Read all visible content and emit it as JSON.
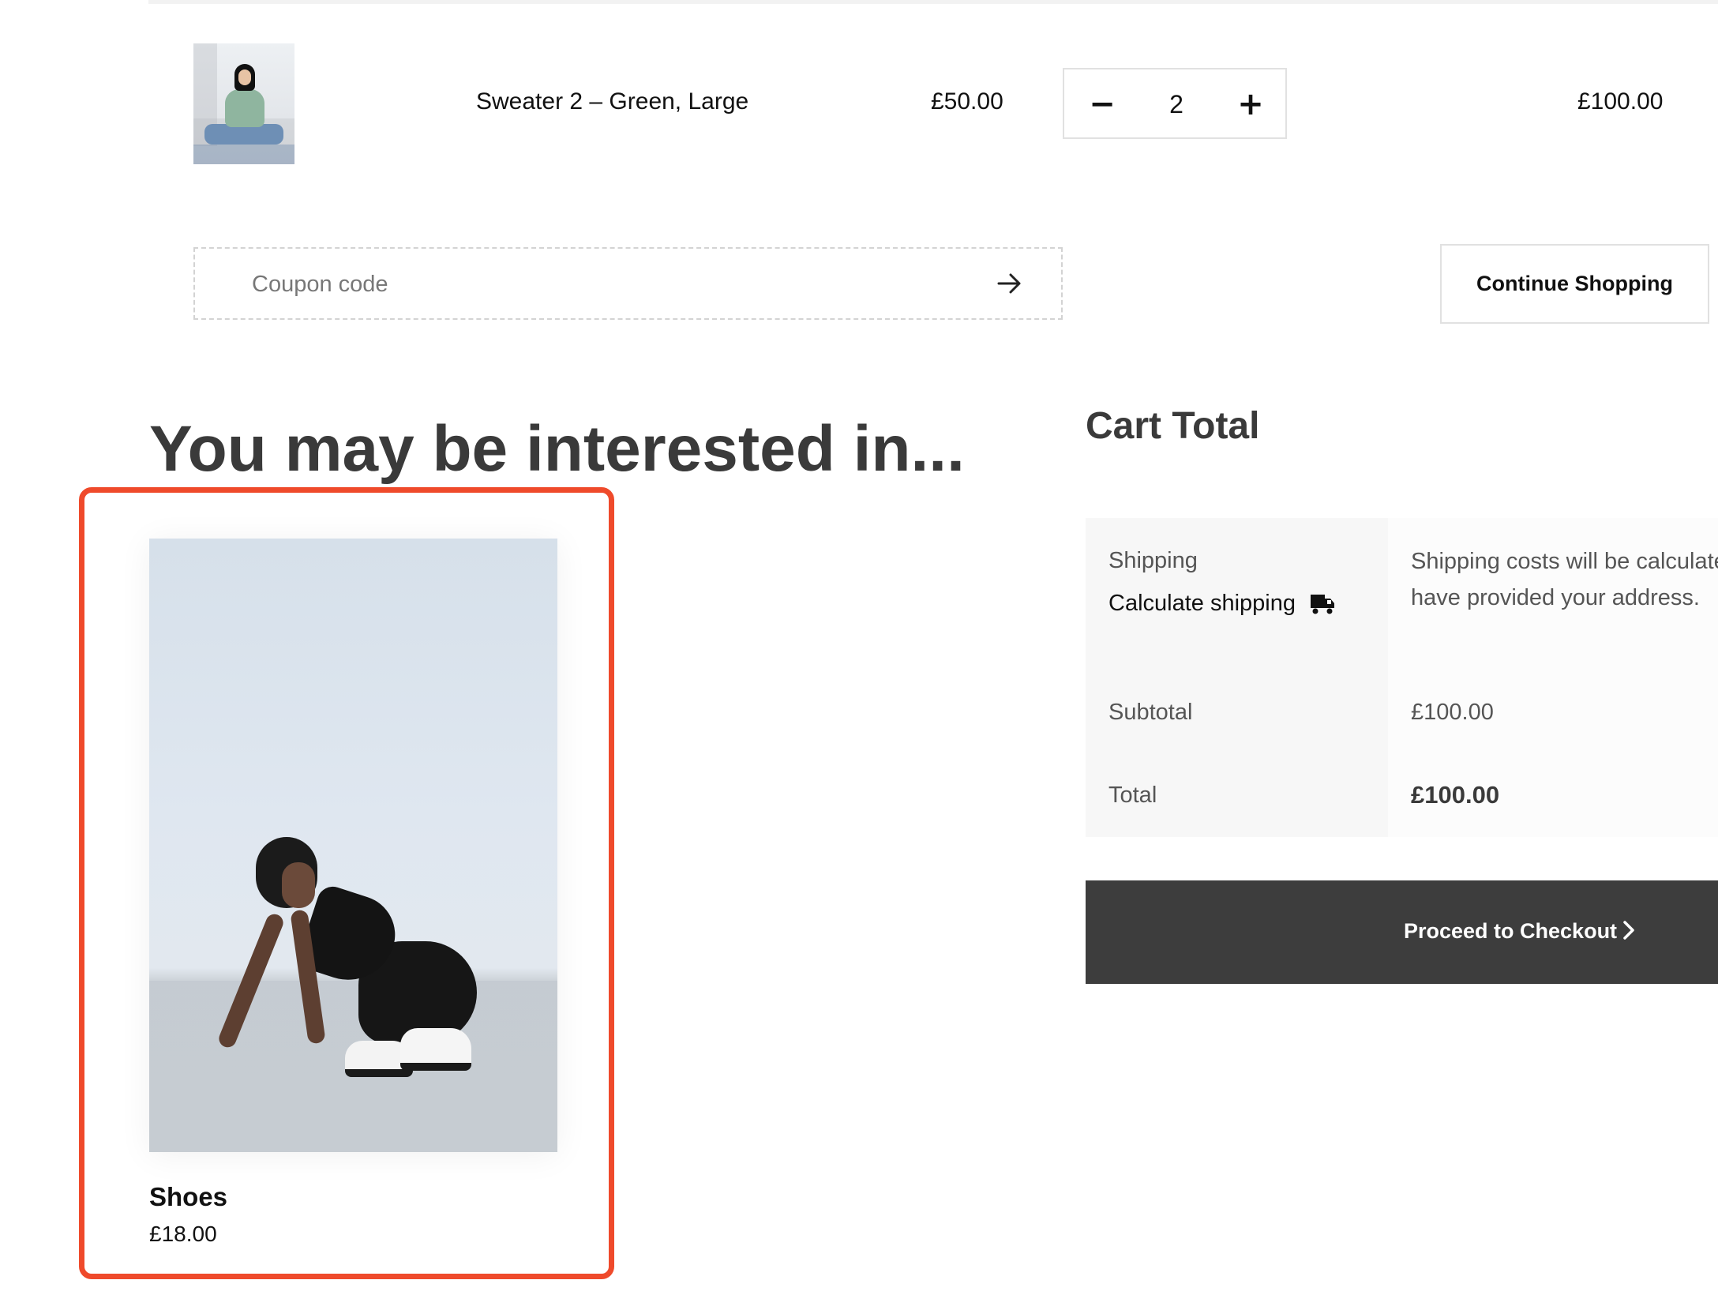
{
  "cart_item": {
    "name": "Sweater 2 – Green, Large",
    "price": "£50.00",
    "quantity": "2",
    "subtotal": "£100.00",
    "qty_minus_symbol": "−",
    "qty_plus_symbol": "+",
    "thumbnail_icon": "product-thumbnail"
  },
  "coupon": {
    "placeholder": "Coupon code",
    "submit_icon": "arrow-right-icon"
  },
  "continue_shopping": {
    "label": "Continue Shopping"
  },
  "recommendations": {
    "heading": "You may be interested in...",
    "products": [
      {
        "name": "Shoes",
        "price": "£18.00"
      }
    ]
  },
  "cart_total": {
    "heading": "Cart Total",
    "shipping_label": "Shipping",
    "calculate_shipping": "Calculate shipping",
    "shipping_icon": "truck-icon",
    "shipping_note": "Shipping costs will be calculated once you have provided your address.",
    "subtotal_label": "Subtotal",
    "subtotal_value": "£100.00",
    "total_label": "Total",
    "total_value": "£100.00"
  },
  "checkout": {
    "label": "Proceed to Checkout",
    "icon": "chevron-right-icon"
  },
  "colors": {
    "highlight_border": "#ef4a2b",
    "checkout_bg": "#3d3d3d",
    "heading_text": "#3a3a3a"
  }
}
